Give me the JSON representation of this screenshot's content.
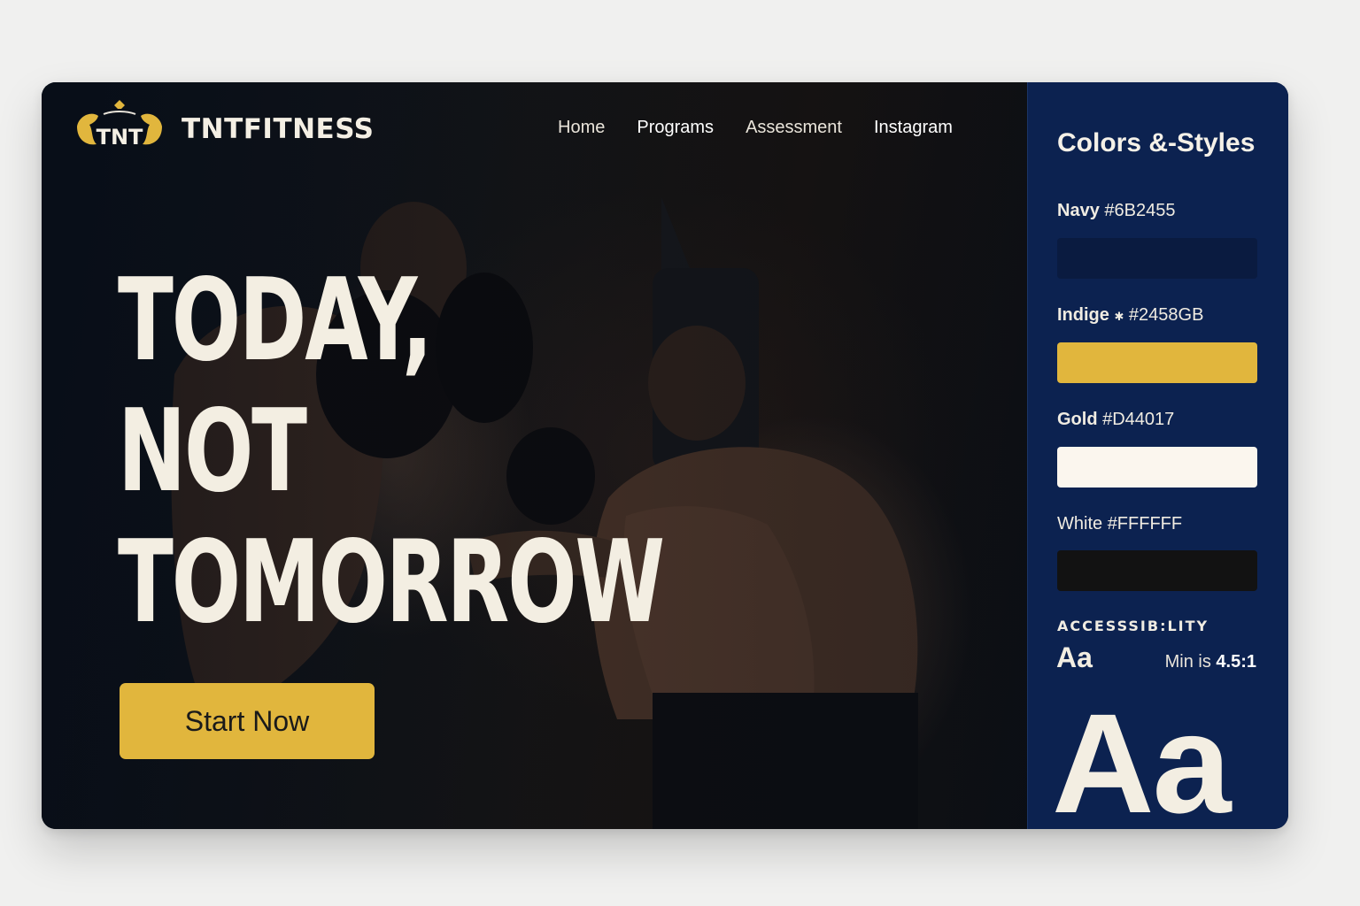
{
  "brand": {
    "logo_text": "TNT",
    "name": "TNTFITNESS"
  },
  "nav": {
    "items": [
      {
        "label": "Home"
      },
      {
        "label": "Programs"
      },
      {
        "label": "Assessment"
      },
      {
        "label": "Instagram"
      }
    ]
  },
  "hero": {
    "headline": [
      "TODAY,",
      "NOT",
      "TOMORROW"
    ],
    "cta_label": "Start Now"
  },
  "panel": {
    "title": "Colors &-Styles",
    "swatches": [
      {
        "name": "Navy",
        "code": "#6B2455",
        "color": "#0a1b40"
      },
      {
        "name": "Indige",
        "code": "#2458GB",
        "color": "#e1b63d"
      },
      {
        "name": "Gold",
        "code": "#D44017",
        "color": "#fbf6ee"
      },
      {
        "name": "White",
        "code": "#FFFFFF",
        "color": "#121212"
      }
    ],
    "accessibility_title": "ACCESSSIB:LITY",
    "aa_small": "Aa",
    "ratio_prefix": "Min is",
    "ratio_value": "4.5:1",
    "aa_big": "Aa"
  },
  "colors": {
    "background": "#f0f0ef",
    "hero_dark": "#0a111c",
    "panel_navy": "#0c2250",
    "gold": "#e1b63d",
    "cream": "#f3eee2"
  }
}
